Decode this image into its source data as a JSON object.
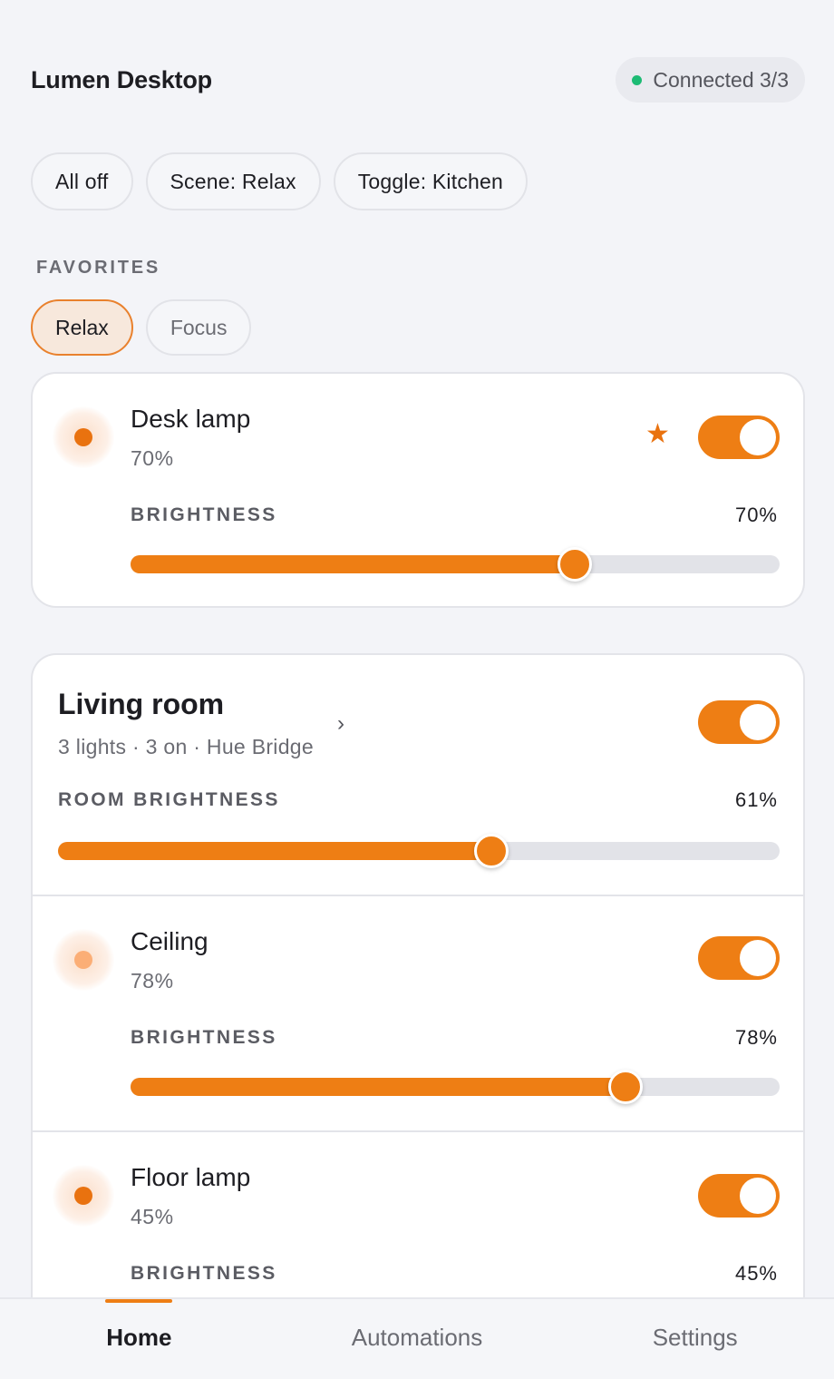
{
  "header": {
    "title": "Lumen Desktop",
    "connection": "Connected 3/3",
    "connection_color": "#1dbb74"
  },
  "quick_actions": [
    {
      "label": "All off"
    },
    {
      "label": "Scene: Relax"
    },
    {
      "label": "Toggle: Kitchen"
    }
  ],
  "favorites": {
    "label": "FAVORITES",
    "items": [
      {
        "label": "Relax",
        "active": true
      },
      {
        "label": "Focus",
        "active": false
      }
    ]
  },
  "favorite_light": {
    "name": "Desk lamp",
    "level": "70%",
    "brightness_label": "BRIGHTNESS",
    "brightness_value": "70%",
    "brightness": 0.685,
    "on": true,
    "starred": true,
    "icon": "star-icon"
  },
  "room": {
    "title": "Living room",
    "meta": "3 lights · 3 on · Hue Bridge",
    "chevron": "›",
    "brightness_label": "ROOM BRIGHTNESS",
    "brightness_value": "61%",
    "brightness": 0.6,
    "on": true,
    "lights": [
      {
        "name": "Ceiling",
        "level": "78%",
        "brightness_label": "BRIGHTNESS",
        "brightness_value": "78%",
        "brightness": 0.762,
        "on": true,
        "dim": true
      },
      {
        "name": "Floor lamp",
        "level": "45%",
        "brightness_label": "BRIGHTNESS",
        "brightness_value": "45%",
        "brightness": 0.45,
        "on": true,
        "dim": false
      }
    ]
  },
  "tabs": [
    {
      "label": "Home",
      "active": true
    },
    {
      "label": "Automations",
      "active": false
    },
    {
      "label": "Settings",
      "active": false
    }
  ],
  "colors": {
    "accent": "#ee7e14",
    "background": "#f3f4f8",
    "card": "#ffffff"
  }
}
